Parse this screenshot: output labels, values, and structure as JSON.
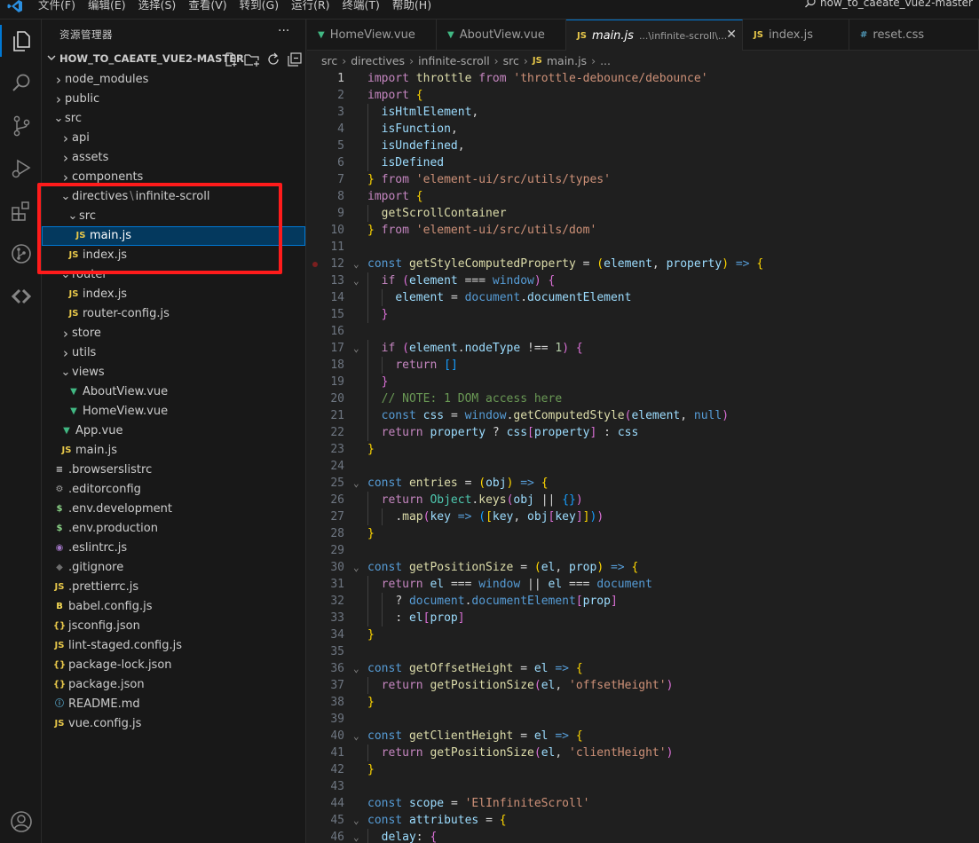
{
  "titlebar": {
    "menus": [
      "文件(F)",
      "编辑(E)",
      "选择(S)",
      "查看(V)",
      "转到(G)",
      "运行(R)",
      "终端(T)",
      "帮助(H)"
    ],
    "search_text": "how_to_caeate_vue2-master"
  },
  "activity_bar": {
    "items": [
      "explorer-icon",
      "search-icon",
      "source-control-icon",
      "run-debug-icon",
      "extensions-icon",
      "git-graph-icon",
      "remote-icon",
      "account-icon"
    ]
  },
  "sidebar": {
    "title": "资源管理器",
    "more": "···",
    "project_name": "HOW_TO_CAEATE_VUE2-MASTER",
    "tree": [
      {
        "label": "node_modules",
        "depth": 1,
        "twisty": "closed",
        "icon": ""
      },
      {
        "label": "public",
        "depth": 1,
        "twisty": "closed",
        "icon": ""
      },
      {
        "label": "src",
        "depth": 1,
        "twisty": "open",
        "icon": ""
      },
      {
        "label": "api",
        "depth": 2,
        "twisty": "closed",
        "icon": ""
      },
      {
        "label": "assets",
        "depth": 2,
        "twisty": "closed",
        "icon": ""
      },
      {
        "label": "components",
        "depth": 2,
        "twisty": "closed",
        "icon": ""
      },
      {
        "label": "directives",
        "label2": "infinite-scroll",
        "depth": 2,
        "twisty": "open",
        "icon": ""
      },
      {
        "label": "src",
        "depth": 3,
        "twisty": "open",
        "icon": ""
      },
      {
        "label": "main.js",
        "depth": 4,
        "twisty": "",
        "icon": "js",
        "selected": true
      },
      {
        "label": "index.js",
        "depth": 3,
        "twisty": "",
        "icon": "js"
      },
      {
        "label": "router",
        "depth": 2,
        "twisty": "open",
        "icon": ""
      },
      {
        "label": "index.js",
        "depth": 3,
        "twisty": "",
        "icon": "js"
      },
      {
        "label": "router-config.js",
        "depth": 3,
        "twisty": "",
        "icon": "js"
      },
      {
        "label": "store",
        "depth": 2,
        "twisty": "closed",
        "icon": ""
      },
      {
        "label": "utils",
        "depth": 2,
        "twisty": "closed",
        "icon": ""
      },
      {
        "label": "views",
        "depth": 2,
        "twisty": "open",
        "icon": ""
      },
      {
        "label": "AboutView.vue",
        "depth": 3,
        "twisty": "",
        "icon": "vue"
      },
      {
        "label": "HomeView.vue",
        "depth": 3,
        "twisty": "",
        "icon": "vue"
      },
      {
        "label": "App.vue",
        "depth": 2,
        "twisty": "",
        "icon": "vue"
      },
      {
        "label": "main.js",
        "depth": 2,
        "twisty": "",
        "icon": "js"
      },
      {
        "label": ".browserslistrc",
        "depth": 1,
        "twisty": "",
        "icon": "lines"
      },
      {
        "label": ".editorconfig",
        "depth": 1,
        "twisty": "",
        "icon": "gear"
      },
      {
        "label": ".env.development",
        "depth": 1,
        "twisty": "",
        "icon": "dollar"
      },
      {
        "label": ".env.production",
        "depth": 1,
        "twisty": "",
        "icon": "dollar"
      },
      {
        "label": ".eslintrc.js",
        "depth": 1,
        "twisty": "",
        "icon": "eslint"
      },
      {
        "label": ".gitignore",
        "depth": 1,
        "twisty": "",
        "icon": "git"
      },
      {
        "label": ".prettierrc.js",
        "depth": 1,
        "twisty": "",
        "icon": "js"
      },
      {
        "label": "babel.config.js",
        "depth": 1,
        "twisty": "",
        "icon": "babel"
      },
      {
        "label": "jsconfig.json",
        "depth": 1,
        "twisty": "",
        "icon": "json"
      },
      {
        "label": "lint-staged.config.js",
        "depth": 1,
        "twisty": "",
        "icon": "js"
      },
      {
        "label": "package-lock.json",
        "depth": 1,
        "twisty": "",
        "icon": "json"
      },
      {
        "label": "package.json",
        "depth": 1,
        "twisty": "",
        "icon": "json"
      },
      {
        "label": "README.md",
        "depth": 1,
        "twisty": "",
        "icon": "info"
      },
      {
        "label": "vue.config.js",
        "depth": 1,
        "twisty": "",
        "icon": "js"
      }
    ]
  },
  "tabs": [
    {
      "label": "HomeView.vue",
      "icon": "vue",
      "description": "",
      "active": false
    },
    {
      "label": "AboutView.vue",
      "icon": "vue",
      "description": "",
      "active": false
    },
    {
      "label": "main.js",
      "icon": "js",
      "description": "...\\infinite-scroll\\...",
      "active": true
    },
    {
      "label": "index.js",
      "icon": "js",
      "description": "",
      "active": false
    },
    {
      "label": "reset.css",
      "icon": "css",
      "description": "",
      "active": false
    }
  ],
  "breadcrumbs": [
    "src",
    "directives",
    "infinite-scroll",
    "src",
    "main.js",
    "..."
  ],
  "editor": {
    "current_line": 1,
    "lines": [
      "import throttle from 'throttle-debounce/debounce'",
      "import {",
      "  isHtmlElement,",
      "  isFunction,",
      "  isUndefined,",
      "  isDefined",
      "} from 'element-ui/src/utils/types'",
      "import {",
      "  getScrollContainer",
      "} from 'element-ui/src/utils/dom'",
      "",
      "const getStyleComputedProperty = (element, property) => {",
      "  if (element === window) {",
      "    element = document.documentElement",
      "  }",
      "",
      "  if (element.nodeType !== 1) {",
      "    return []",
      "  }",
      "  // NOTE: 1 DOM access here",
      "  const css = window.getComputedStyle(element, null)",
      "  return property ? css[property] : css",
      "}",
      "",
      "const entries = (obj) => {",
      "  return Object.keys(obj || {})",
      "    .map(key => ([key, obj[key]]))",
      "}",
      "",
      "const getPositionSize = (el, prop) => {",
      "  return el === window || el === document",
      "    ? document.documentElement[prop]",
      "    : el[prop]",
      "}",
      "",
      "const getOffsetHeight = el => {",
      "  return getPositionSize(el, 'offsetHeight')",
      "}",
      "",
      "const getClientHeight = el => {",
      "  return getPositionSize(el, 'clientHeight')",
      "}",
      "",
      "const scope = 'ElInfiniteScroll'",
      "const attributes = {",
      "  delay: {"
    ],
    "fold_lines": [
      12,
      13,
      17,
      25,
      30,
      36,
      40,
      45,
      46
    ],
    "breakpoint_lines": [
      12
    ]
  }
}
